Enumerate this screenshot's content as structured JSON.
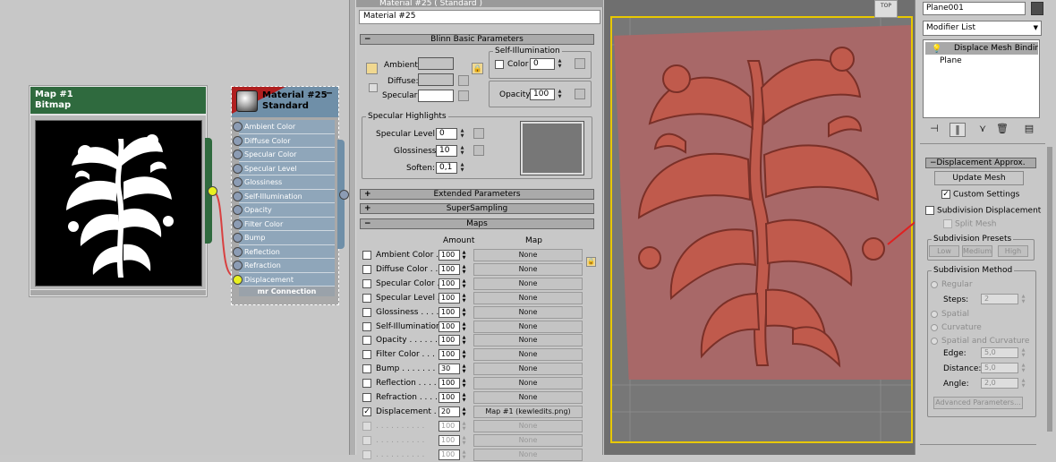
{
  "node_editor": {
    "map_node": {
      "title": "Map #1",
      "subtitle": "Bitmap"
    },
    "material_node": {
      "title": "Material #25",
      "subtitle": "Standard",
      "slots": [
        "Ambient Color",
        "Diffuse Color",
        "Specular Color",
        "Specular Level",
        "Glossiness",
        "Self-Illumination",
        "Opacity",
        "Filter Color",
        "Bump",
        "Reflection",
        "Refraction",
        "Displacement"
      ],
      "active_slot": "Displacement",
      "footer": "mr Connection"
    }
  },
  "material_editor": {
    "topbar_title": "Material #25 ( Standard )",
    "material_name": "Material #25",
    "blinn": {
      "rollout": "Blinn Basic Parameters",
      "ambient_label": "Ambient:",
      "diffuse_label": "Diffuse:",
      "specular_label": "Specular:",
      "self_illum_title": "Self-Illumination",
      "color_label": "Color",
      "color_value": "0",
      "opacity_label": "Opacity:",
      "opacity_value": "100",
      "highlights_title": "Specular Highlights",
      "spec_level_label": "Specular Level:",
      "spec_level_value": "0",
      "glossiness_label": "Glossiness:",
      "glossiness_value": "10",
      "soften_label": "Soften:",
      "soften_value": "0,1"
    },
    "rollouts": {
      "extended": "Extended Parameters",
      "supersampling": "SuperSampling",
      "maps": "Maps"
    },
    "maps": {
      "amount_header": "Amount",
      "map_header": "Map",
      "rows": [
        {
          "name": "Ambient Color . .",
          "amount": "100",
          "map": "None",
          "checked": false
        },
        {
          "name": "Diffuse Color . .",
          "amount": "100",
          "map": "None",
          "checked": false
        },
        {
          "name": "Specular Color . .",
          "amount": "100",
          "map": "None",
          "checked": false
        },
        {
          "name": "Specular Level . .",
          "amount": "100",
          "map": "None",
          "checked": false
        },
        {
          "name": "Glossiness . . . .",
          "amount": "100",
          "map": "None",
          "checked": false
        },
        {
          "name": "Self-Illumination .",
          "amount": "100",
          "map": "None",
          "checked": false
        },
        {
          "name": "Opacity . . . . . .",
          "amount": "100",
          "map": "None",
          "checked": false
        },
        {
          "name": "Filter Color . . .",
          "amount": "100",
          "map": "None",
          "checked": false
        },
        {
          "name": "Bump . . . . . . .",
          "amount": "30",
          "map": "None",
          "checked": false
        },
        {
          "name": "Reflection . . . .",
          "amount": "100",
          "map": "None",
          "checked": false
        },
        {
          "name": "Refraction . . . .",
          "amount": "100",
          "map": "None",
          "checked": false
        },
        {
          "name": "Displacement . . .",
          "amount": "20",
          "map": "Map #1 (kewledits.png)",
          "checked": true
        },
        {
          "name": ". . . . . . . . . .",
          "amount": "100",
          "map": "None",
          "checked": false
        },
        {
          "name": ". . . . . . . . . .",
          "amount": "100",
          "map": "None",
          "checked": false
        },
        {
          "name": ". . . . . . . . . .",
          "amount": "100",
          "map": "None",
          "checked": false
        }
      ]
    }
  },
  "viewport": {
    "viewcube_label": "TOP"
  },
  "command_panel": {
    "object_name": "Plane001",
    "object_color": "#4c4c4c",
    "modifier_list": "Modifier List",
    "stack": [
      "Displace Mesh Binding (W",
      "Plane"
    ],
    "displacement_rollout": "Displacement Approx.",
    "update_mesh": "Update Mesh",
    "custom_settings": "Custom Settings",
    "subdivision_displacement": "Subdivision Displacement",
    "split_mesh": "Split Mesh",
    "presets_title": "Subdivision Presets",
    "presets": [
      "Low",
      "Medium",
      "High"
    ],
    "method_title": "Subdivision Method",
    "regular": "Regular",
    "steps_label": "Steps:",
    "steps_value": "2",
    "spatial": "Spatial",
    "curvature": "Curvature",
    "spatial_curvature": "Spatial and Curvature",
    "edge_label": "Edge:",
    "edge_value": "5,0",
    "distance_label": "Distance:",
    "distance_value": "5,0",
    "angle_label": "Angle:",
    "angle_value": "2,0",
    "advanced": "Advanced Parameters..."
  },
  "colors": {
    "accent_arrow": "#e02020",
    "plane": "#a86868",
    "map_node": "#2f6a3e",
    "material_node": "#6f8fa8"
  }
}
